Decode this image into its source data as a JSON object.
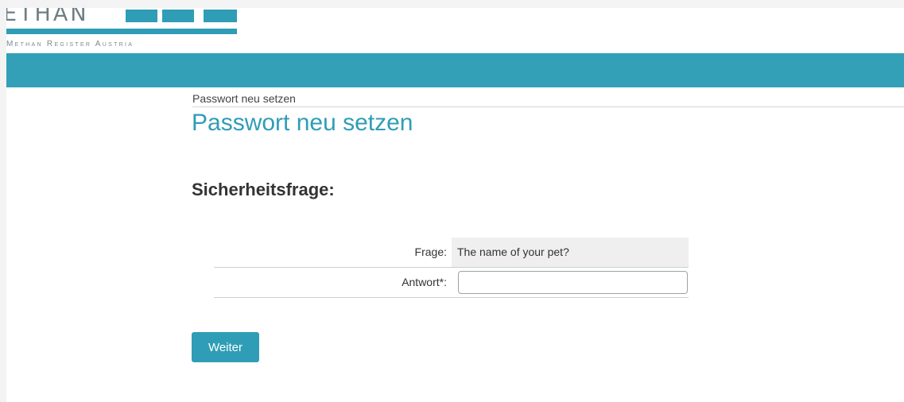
{
  "brand": {
    "logo_word": "ETHAN",
    "logo_tagline": "Methan Register Austria",
    "accent_color": "#2f9db6"
  },
  "breadcrumb": "Passwort neu setzen",
  "page_title": "Passwort neu setzen",
  "section_title": "Sicherheitsfrage:",
  "form": {
    "question_label": "Frage:",
    "question_value": "The name of your pet?",
    "answer_label": "Antwort*:",
    "answer_value": ""
  },
  "submit_label": "Weiter"
}
